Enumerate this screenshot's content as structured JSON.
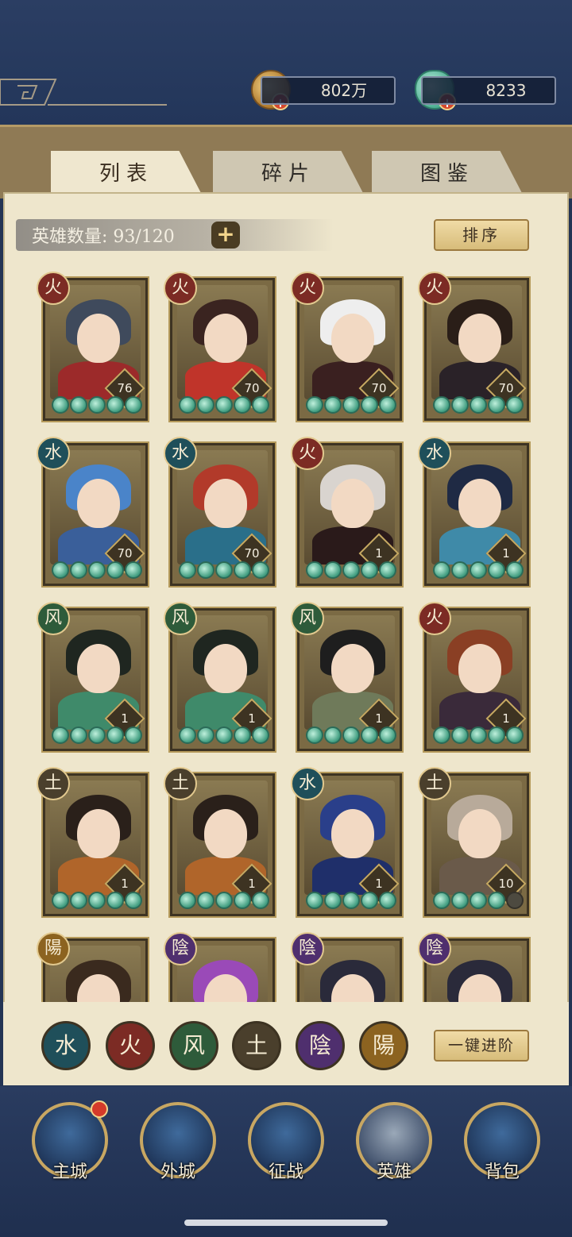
{
  "currency": {
    "coins": "802万",
    "jade": "8233",
    "plus": "+"
  },
  "tabs": [
    "列表",
    "碎片",
    "图鉴"
  ],
  "hero_count_label": "英雄数量: 93/120",
  "count_plus": "+",
  "sort_button": "排序",
  "elements": {
    "fire": "火",
    "water": "水",
    "wind": "风",
    "earth": "土",
    "yin": "陰",
    "yang": "陽"
  },
  "heroes": [
    {
      "element": "火",
      "level": "76",
      "stars": 5,
      "hair": "#3f4a5c",
      "body": "#9c2a2a"
    },
    {
      "element": "火",
      "level": "70",
      "stars": 5,
      "hair": "#3a2420",
      "body": "#c0342a"
    },
    {
      "element": "火",
      "level": "70",
      "stars": 5,
      "hair": "#eeeeee",
      "body": "#3a2020"
    },
    {
      "element": "火",
      "level": "70",
      "stars": 5,
      "hair": "#2a1e18",
      "body": "#2a2228"
    },
    {
      "element": "水",
      "level": "70",
      "stars": 5,
      "hair": "#4a84c9",
      "body": "#3a5f9a"
    },
    {
      "element": "水",
      "level": "70",
      "stars": 5,
      "hair": "#b23a2a",
      "body": "#2a6f8a"
    },
    {
      "element": "火",
      "level": "1",
      "stars": 5,
      "hair": "#d9d4cf",
      "body": "#2a1a1a"
    },
    {
      "element": "水",
      "level": "1",
      "stars": 5,
      "hair": "#1f2a44",
      "body": "#3f8aa8"
    },
    {
      "element": "风",
      "level": "1",
      "stars": 5,
      "hair": "#1f2620",
      "body": "#3f8a6a"
    },
    {
      "element": "风",
      "level": "1",
      "stars": 5,
      "hair": "#1f2620",
      "body": "#3f8a6a"
    },
    {
      "element": "风",
      "level": "1",
      "stars": 5,
      "hair": "#1e1e1e",
      "body": "#6f7a5a"
    },
    {
      "element": "火",
      "level": "1",
      "stars": 5,
      "hair": "#8a3f24",
      "body": "#3a2a3a"
    },
    {
      "element": "土",
      "level": "1",
      "stars": 5,
      "hair": "#2a201a",
      "body": "#b0652a"
    },
    {
      "element": "土",
      "level": "1",
      "stars": 5,
      "hair": "#2a201a",
      "body": "#b0652a"
    },
    {
      "element": "水",
      "level": "1",
      "stars": 5,
      "hair": "#2a3f8a",
      "body": "#1f2f6a"
    },
    {
      "element": "土",
      "level": "10",
      "stars": 4,
      "hair": "#b8aa9a",
      "body": "#6a5a4a"
    },
    {
      "element": "陽",
      "level": "",
      "stars": 0,
      "hair": "#3a2a1e",
      "body": "#6a5a3a"
    },
    {
      "element": "陰",
      "level": "",
      "stars": 0,
      "hair": "#9a4ab8",
      "body": "#4a2a6a"
    },
    {
      "element": "陰",
      "level": "",
      "stars": 0,
      "hair": "#2a2a3a",
      "body": "#3a3a4a"
    },
    {
      "element": "陰",
      "level": "",
      "stars": 0,
      "hair": "#2a2a3a",
      "body": "#3a3a4a"
    }
  ],
  "advance_button": "一键进阶",
  "nav": [
    "主城",
    "外城",
    "征战",
    "英雄",
    "背包"
  ],
  "colors": {
    "accent_gold": "#c8a762",
    "panel": "#eee6cc",
    "nav_bg": "#233454",
    "notification": "#d43a2a"
  }
}
